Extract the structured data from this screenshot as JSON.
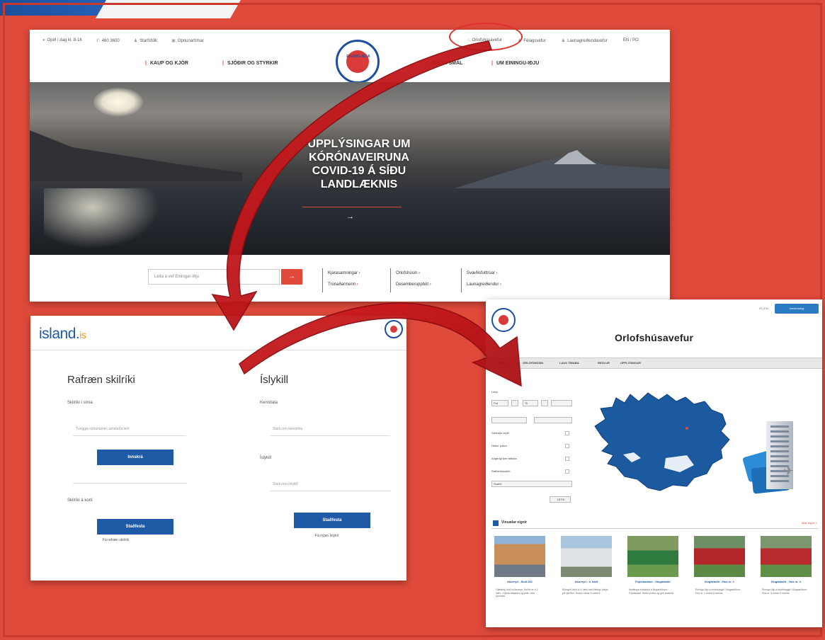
{
  "eining": {
    "top_left": [
      "Opið í dag kl. 8-16",
      "460 3600",
      "Starfsfólk",
      "Opnunartímar"
    ],
    "top_right": [
      "Orlofshúsavefur",
      "Félagsvefur",
      "Launagreiðendavefur",
      "EN / PO"
    ],
    "logo_text": "EINING-IÐJA",
    "nav_left": [
      "KAUP OG KJÖR",
      "SJÓÐIR OG STYRKIR"
    ],
    "nav_right": [
      "ORLOFSMÁL",
      "UM EININGU-IÐJU"
    ],
    "hero_lines": [
      "UPPLÝSINGAR UM",
      "KÓRÓNAVEIRUNA",
      "COVID-19 Á SÍÐU",
      "LANDLÆKNIS"
    ],
    "hero_arrow": "→",
    "search_placeholder": "Leita á vef Einingar-Iðju",
    "search_button": "→",
    "quicklinks": [
      [
        "Kjarasamningar",
        "Trúnaðarmenn"
      ],
      [
        "Orlofshúsin",
        "Desemberuppbót"
      ],
      [
        "Svæðisfulltrúar",
        "Launagreiðendur"
      ]
    ]
  },
  "island": {
    "logo_main": "island.",
    "logo_suffix": "is",
    "left": {
      "title": "Rafræn skilríki",
      "phone_label": "Skilríki í síma",
      "phone_placeholder": "Tveggja símanúmer, umritaða leið",
      "login_button": "Innskrá",
      "card_label": "Skilríki á korti",
      "confirm_button": "Staðfesta",
      "help_text": "Fá rafræn skilríki"
    },
    "right": {
      "title": "Íslykill",
      "kennitala_label": "Kennitala",
      "kennitala_placeholder": "Slaðu inn kennitölu",
      "password_label": "Íslykill",
      "password_placeholder": "Slaðu inn Íslykill",
      "confirm_button": "Staðfesta",
      "help_text": "Fá nýjan Íslykil"
    }
  },
  "orlof": {
    "title": "Orlofshúsavefur",
    "top_button": "Innskráning",
    "flags": "IS | EN",
    "nav": [
      "FORSÍÐA",
      "ORLOFSHÚSIN",
      "LAUS TÍMABIL",
      "REGLUR",
      "UPPLÝSINGAR"
    ],
    "filters": {
      "search_label": "Leita",
      "date_from": "Frá",
      "date_to": "Til",
      "checkboxes": [
        "Gæludýr leyfð",
        "Heitur pottur",
        "Aðgengi fyrir fatlaða",
        "Rafhleðslustöð"
      ],
      "dropdown": "Svæði",
      "button": "LEITA"
    },
    "section_title": "Vinsælar eignir",
    "section_link": "Allar eignir »",
    "cards": [
      {
        "title": "Akureyri - Íbúð 201",
        "desc": "Glæsileg íbúð á Akureyri. Íbúðin er á 2. hæð, í hjarta bæjarins og stutt í alla þjónustu."
      },
      {
        "title": "Akureyri - 4. hæð",
        "desc": "Rúmgóð íbúð á 4. hæð með fallegu útsýni yfir fjörðinn. Íbúðin rúmar 6 manns."
      },
      {
        "title": "Fnjóskadalur - Illugastaðir",
        "desc": "Notalegur bústaður á Illugastöðum í Fnjóskadal. Heitur pottur og góð aðstaða."
      },
      {
        "title": "Illugastaðir - Hús nr. 1",
        "desc": "Einingu-Iðju á orlofsbyggð í Illugastöðum. Hús nr. 1 rúmar 6 manns."
      },
      {
        "title": "Illugastaðir - Hús nr. 4",
        "desc": "Einingu-Iðju á orlofsbyggð í Illugastöðum. Hús nr. 4 rúmar 6 manns."
      }
    ]
  },
  "colors": {
    "background": "#e04a3a",
    "arrow": "#c8171b",
    "island_blue": "#1f5aa6"
  }
}
